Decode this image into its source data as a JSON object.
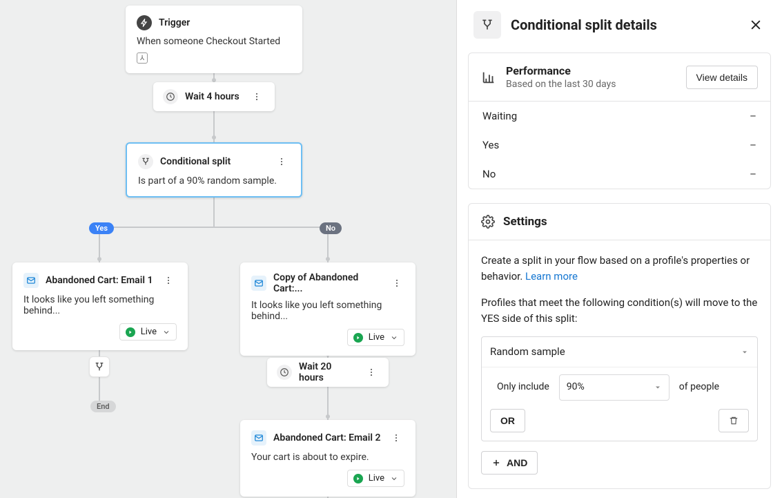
{
  "canvas": {
    "trigger": {
      "title": "Trigger",
      "desc": "When someone Checkout Started"
    },
    "wait1": {
      "label": "Wait 4 hours"
    },
    "wait2": {
      "label": "Wait 20 hours"
    },
    "csplit": {
      "title": "Conditional split",
      "desc": "Is part of a 90% random sample."
    },
    "yes_label": "Yes",
    "no_label": "No",
    "end_label": "End",
    "email1": {
      "title": "Abandoned Cart: Email 1",
      "desc": "It looks like you left something behind...",
      "status": "Live"
    },
    "email2": {
      "title": "Copy of Abandoned Cart:...",
      "desc": "It looks like you left something behind...",
      "status": "Live"
    },
    "email3": {
      "title": "Abandoned Cart: Email 2",
      "desc": "Your cart is about to expire.",
      "status": "Live"
    }
  },
  "panel": {
    "title": "Conditional split details",
    "performance": {
      "title": "Performance",
      "subtitle": "Based on the last 30 days",
      "view_label": "View details",
      "rows": [
        {
          "label": "Waiting",
          "value": "–"
        },
        {
          "label": "Yes",
          "value": "–"
        },
        {
          "label": "No",
          "value": "–"
        }
      ]
    },
    "settings": {
      "title": "Settings",
      "desc_prefix": "Create a split in your flow based on a profile's properties or behavior. ",
      "learn_more": "Learn more",
      "condition_intro": "Profiles that meet the following condition(s) will move to the YES side of this split:",
      "condition_type": "Random sample",
      "only_include": "Only include",
      "percent": "90%",
      "of_people": "of people",
      "or_label": "OR",
      "and_label": "AND"
    }
  }
}
